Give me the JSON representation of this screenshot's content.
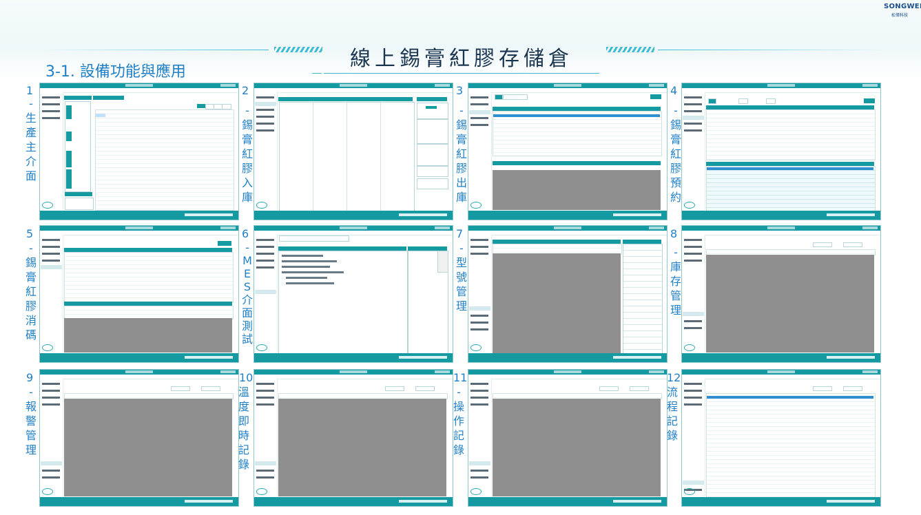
{
  "header": {
    "logo_text": "SONGWEI",
    "logo_subtext": "松偉科技",
    "main_title": "線上錫膏紅膠存儲倉",
    "section_title": "3-1. 設備功能與應用"
  },
  "panels": [
    {
      "num": "1",
      "label": "-生產主介面"
    },
    {
      "num": "2",
      "label": "-錫膏紅膠入庫"
    },
    {
      "num": "3",
      "label": "-錫膏紅膠出庫"
    },
    {
      "num": "4",
      "label": "-錫膏紅膠預約"
    },
    {
      "num": "5",
      "label": "-錫膏紅膠消碼"
    },
    {
      "num": "6",
      "label": "-MES介面測試"
    },
    {
      "num": "7",
      "label": "-型號管理"
    },
    {
      "num": "8",
      "label": "-庫存管理"
    },
    {
      "num": "9",
      "label": "-報警管理"
    },
    {
      "num": "10.",
      "label": "溫度即時記錄"
    },
    {
      "num": "11",
      "label": "-操作記錄"
    },
    {
      "num": "12.",
      "label": "流程記錄"
    }
  ],
  "colors": {
    "accent": "#169aa2",
    "title_blue": "#1f7fc7",
    "headline": "#1a3550",
    "grid_grey": "#8f8f8f"
  }
}
